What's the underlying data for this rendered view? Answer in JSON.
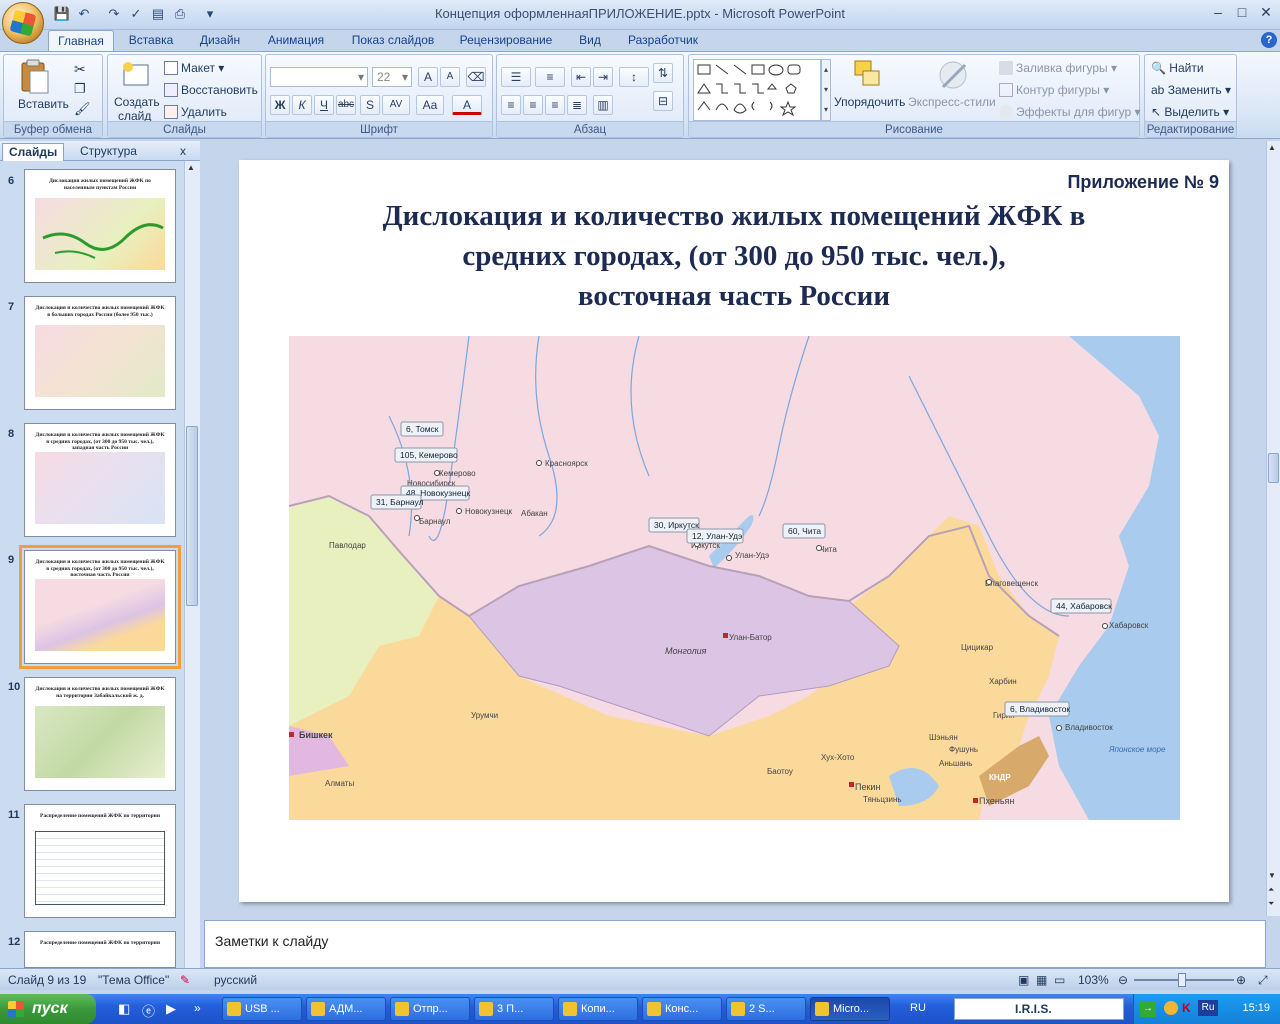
{
  "window": {
    "title": "Концепция оформленнаяПРИЛОЖЕНИЕ.pptx - Microsoft PowerPoint",
    "minimize": "–",
    "maximize": "□",
    "close": "✕",
    "help": "?"
  },
  "ribbon": {
    "tabs": [
      "Главная",
      "Вставка",
      "Дизайн",
      "Анимация",
      "Показ слайдов",
      "Рецензирование",
      "Вид",
      "Разработчик"
    ],
    "active_tab": "Главная",
    "clipboard": {
      "paste": "Вставить",
      "group": "Буфер обмена"
    },
    "slides": {
      "create": "Создать",
      "create2": "слайд",
      "layout": "Макет",
      "reset": "Восстановить",
      "delete": "Удалить",
      "group": "Слайды"
    },
    "font": {
      "size": "22",
      "group": "Шрифт"
    },
    "paragraph": {
      "group": "Абзац"
    },
    "drawing": {
      "arrange": "Упорядочить",
      "quick_styles": "Экспресс-стили",
      "fill": "Заливка фигуры",
      "outline": "Контур фигуры",
      "effects": "Эффекты для фигур",
      "group": "Рисование"
    },
    "editing": {
      "find": "Найти",
      "replace": "Заменить",
      "select": "Выделить",
      "group": "Редактирование"
    }
  },
  "left_panel": {
    "tab_slides": "Слайды",
    "tab_outline": "Структура",
    "close": "x",
    "thumbnails": [
      {
        "num": "6",
        "title": "Дислокация жилых помещений ЖФК по населенным пунктам России"
      },
      {
        "num": "7",
        "title": "Дислокация и количество жилых помещений ЖФК в больших городах России (более 950 тыс.)"
      },
      {
        "num": "8",
        "title": "Дислокация и количество жилых помещений ЖФК в средних городах, (от 300 до 950 тыс. чел.), западная часть России"
      },
      {
        "num": "9",
        "title": "Дислокация и количество жилых помещений ЖФК в средних городах, (от 300 до 950 тыс. чел.), восточная часть России"
      },
      {
        "num": "10",
        "title": "Дислокация и количество жилых помещений ЖФК на территории Забайкальской ж. д."
      },
      {
        "num": "11",
        "title": "Распределение помещений ЖФК по территории"
      },
      {
        "num": "12",
        "title": "Распределение помещений ЖФК по территории"
      }
    ]
  },
  "slide": {
    "appendix": "Приложение № 9",
    "title_line1": "Дислокация и количество жилых помещений ЖФК в",
    "title_line2": "средних городах, (от 300 до 950 тыс. чел.),",
    "title_line3": "восточная часть России"
  },
  "map": {
    "callouts": [
      "6, Томск",
      "105, Кемерово",
      "48, Новокузнецк",
      "31, Барнаул",
      "30, Иркутск",
      "12, Улан-Удэ",
      "60, Чита",
      "44, Хабаровск",
      "6, Владивосток"
    ],
    "places": [
      "Красноярск",
      "Кемерово",
      "Новосибирск",
      "Новокузнецк",
      "Барнаул",
      "Абакан",
      "Павлодар",
      "Иркутск",
      "Улан-Удэ",
      "Чита",
      "Улан-Батор",
      "Монголия",
      "Благовещенск",
      "Хабаровск",
      "Цицикар",
      "Харбин",
      "Гирин",
      "Владивосток",
      "Урумчи",
      "Алматы",
      "Бишкек",
      "Пекин",
      "Тяньцзинь",
      "Хух-Хото",
      "Баотоу",
      "Шэньян",
      "Аньшань",
      "Фушунь",
      "Пхеньян",
      "КНДР",
      "Японское море"
    ],
    "colors": {
      "russia": "#f6dbe2",
      "mongolia": "#dcc4e5",
      "china": "#fbd99a",
      "kazakhstan": "#e8f0c0",
      "water": "#a9cbee",
      "kyrgyzstan": "#e2b8e0"
    }
  },
  "notes": {
    "placeholder": "Заметки к слайду"
  },
  "status": {
    "slide": "Слайд 9 из 19",
    "theme": "\"Тема Office\"",
    "language": "русский",
    "zoom": "103%"
  },
  "taskbar": {
    "start": "пуск",
    "tasks": [
      "USB ...",
      "АДМ...",
      "Отпр...",
      "3 П...",
      "Копи...",
      "Конс...",
      "2 S...",
      "Micro..."
    ],
    "lang": "RU",
    "iris": "I.R.I.S.",
    "time": "15:19"
  }
}
